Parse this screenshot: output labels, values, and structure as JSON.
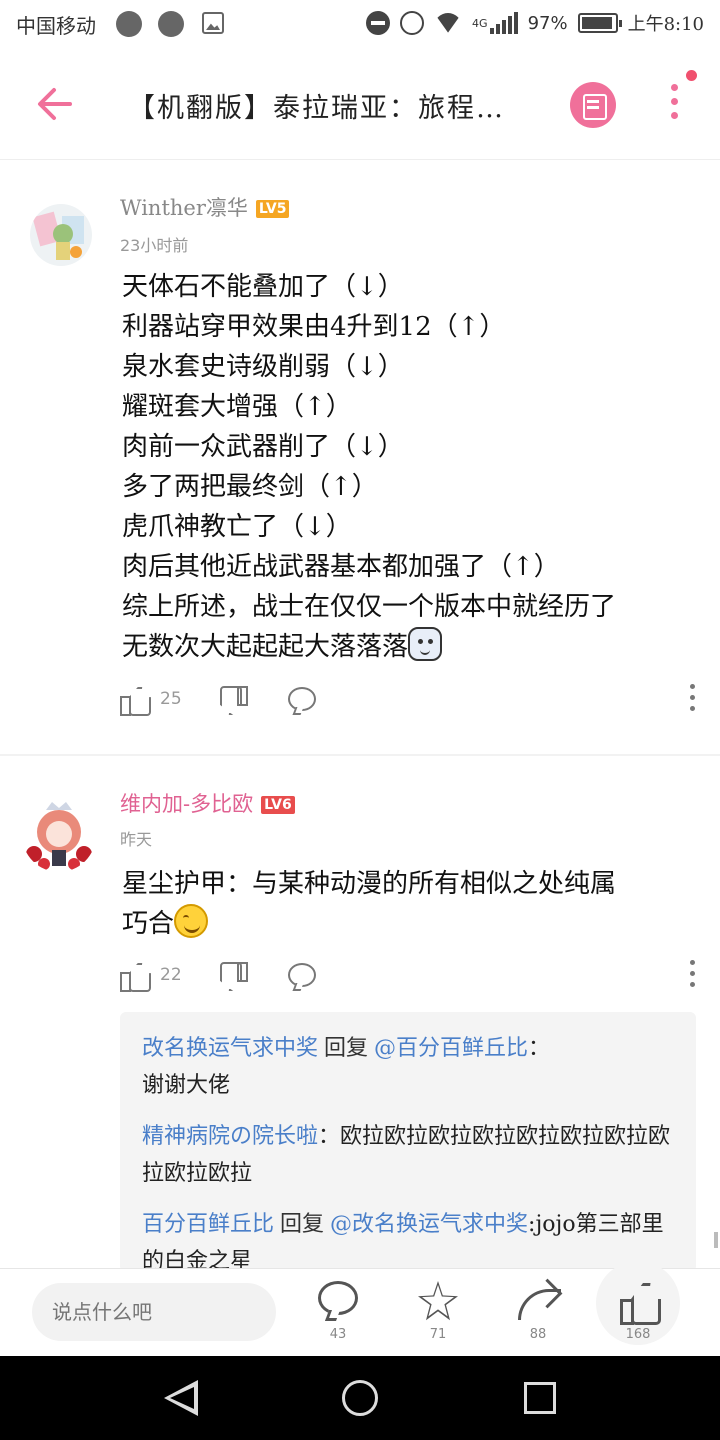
{
  "status_bar": {
    "carrier": "中国移动",
    "network": "4G",
    "battery": "97%",
    "time": "上午8:10"
  },
  "header": {
    "back_icon": "arrow-left-icon",
    "title": "【机翻版】泰拉瑞亚：旅程…",
    "picture_icon": "image-view-icon",
    "more_icon": "more-vertical-icon",
    "accent_color": "#f0709a"
  },
  "comments": [
    {
      "username": "Winther凛华",
      "level": "LV5",
      "time": "23小时前",
      "lines": [
        "天体石不能叠加了（↓）",
        "利器站穿甲效果由4升到12（↑）",
        "泉水套史诗级削弱（↓）",
        "耀斑套大增强（↑）",
        "肉前一众武器削了（↓）",
        "多了两把最终剑（↑）",
        "虎爪神教亡了（↓）",
        "肉后其他近战武器基本都加强了（↑）",
        "综上所述，战士在仅仅一个版本中就经历了",
        "无数次大起起起大落落落"
      ],
      "likes": "25"
    },
    {
      "username": "维内加-多比欧",
      "level": "LV6",
      "time": "昨天",
      "lines": [
        "星尘护甲：与某种动漫的所有相似之处纯属",
        "巧合"
      ],
      "likes": "22",
      "replies": [
        {
          "from": "改名换运气求中奖",
          "verb": "回复",
          "to": "@百分百鲜丘比",
          "sep": "：",
          "text": "谢谢大佬"
        },
        {
          "from": "精神病院の院长啦",
          "verb": "",
          "to": "",
          "sep": "：",
          "text": "欧拉欧拉欧拉欧拉欧拉欧拉欧拉欧拉欧拉欧拉"
        },
        {
          "from": "百分百鲜丘比",
          "verb": "回复",
          "to": "@改名换运气求中奖",
          "sep": "",
          "text": ":jojo第三部里的白金之星"
        }
      ]
    }
  ],
  "bottom_bar": {
    "input_placeholder": "说点什么吧",
    "comments_count": "43",
    "favorites_count": "71",
    "shares_count": "88",
    "likes_count": "168"
  }
}
